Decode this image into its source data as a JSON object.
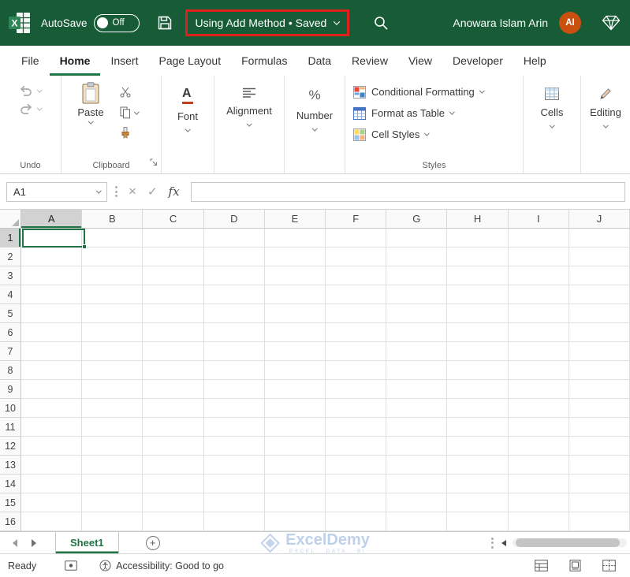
{
  "colors": {
    "titlebar_green": "#185C37",
    "accent_green": "#217346",
    "annotation_red": "#E0201C",
    "avatar_orange": "#CA5010"
  },
  "title_bar": {
    "autosave_label": "AutoSave",
    "autosave_state": "Off",
    "document_title": "Using Add Method • Saved",
    "user_name": "Anowara Islam Arin",
    "avatar_initials": "AI"
  },
  "menu": {
    "tabs": [
      "File",
      "Home",
      "Insert",
      "Page Layout",
      "Formulas",
      "Data",
      "Review",
      "View",
      "Developer",
      "Help"
    ],
    "active_tab": "Home"
  },
  "ribbon": {
    "undo": {
      "label": "Undo"
    },
    "clipboard": {
      "label": "Clipboard",
      "paste_label": "Paste"
    },
    "font": {
      "label": "Font",
      "icon_letter": "A"
    },
    "alignment": {
      "label": "Alignment"
    },
    "number": {
      "label": "Number",
      "symbol": "%"
    },
    "styles": {
      "label": "Styles",
      "items": [
        "Conditional Formatting",
        "Format as Table",
        "Cell Styles"
      ]
    },
    "cells": {
      "label": "Cells"
    },
    "editing": {
      "label": "Editing"
    }
  },
  "formula_bar": {
    "name_box_value": "A1",
    "fx_label": "fx",
    "formula_value": ""
  },
  "grid": {
    "columns": [
      "A",
      "B",
      "C",
      "D",
      "E",
      "F",
      "G",
      "H",
      "I",
      "J"
    ],
    "rows": [
      "1",
      "2",
      "3",
      "4",
      "5",
      "6",
      "7",
      "8",
      "9",
      "10",
      "11",
      "12",
      "13",
      "14",
      "15",
      "16"
    ],
    "selected_cell": "A1"
  },
  "sheet_bar": {
    "tabs": [
      {
        "label": "Sheet1",
        "active": true
      }
    ],
    "watermark": {
      "title": "ExcelDemy",
      "subtitle": "EXCEL · DATA · BI"
    }
  },
  "status_bar": {
    "mode": "Ready",
    "accessibility": "Accessibility: Good to go"
  },
  "icons": {
    "cancel": "×",
    "enter": "✓",
    "add_sheet": "+"
  }
}
